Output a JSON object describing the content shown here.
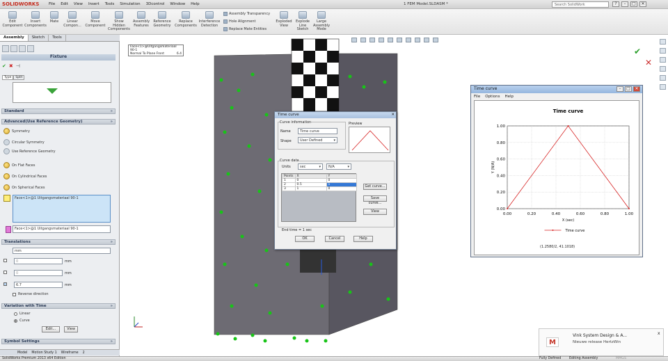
{
  "app": {
    "logo": "SOLIDWORKS",
    "menu": [
      "File",
      "Edit",
      "View",
      "Insert",
      "Tools",
      "Simulation",
      "3Dcontrol",
      "Window",
      "Help"
    ],
    "doc_title": "1 FEM Model.SLDASM *",
    "search_placeholder": "Search SolidWork",
    "win_controls": [
      "?",
      "–",
      "□",
      "✕"
    ]
  },
  "ribbon": {
    "buttons": [
      {
        "label": "Edit Component"
      },
      {
        "label": "Insert Components"
      },
      {
        "label": "Mate"
      },
      {
        "label": "Linear Compon..."
      },
      {
        "label": "Move Component"
      },
      {
        "label": "Show Hidden Components"
      },
      {
        "label": "Assembly Features"
      },
      {
        "label": "Reference Geometry"
      },
      {
        "label": "Replace Components"
      },
      {
        "label": "Interference Detection"
      },
      {
        "label": "Exploded View"
      },
      {
        "label": "Explode Line Sketch"
      },
      {
        "label": "Large Assembly Mode"
      }
    ],
    "small": [
      "Assembly Transparency",
      "Hole Alignment",
      "Replace Mate Entities"
    ]
  },
  "left_panel": {
    "tabs": [
      "Assembly",
      "Sketch",
      "Tools"
    ],
    "title": "Fixture",
    "type_tabs": [
      "Type",
      "Split"
    ],
    "standard_header": "Standard",
    "advanced_header": "Advanced(Use Reference Geometry)",
    "advanced_items": [
      "Symmetry",
      "Circular Symmetry",
      "Use Reference Geometry",
      "On Flat Faces",
      "On Cylindrical Faces",
      "On Spherical Faces"
    ],
    "face_selection": "Face<1>@1 Uitgangsmateriaal 90-1",
    "face_ref": "Face<1>@1 Uitgangsmateriaal 90-1",
    "translations_header": "Translations",
    "unit": "mm",
    "values": [
      {
        "value": "0",
        "unit": "mm"
      },
      {
        "value": "0",
        "unit": "mm"
      },
      {
        "value": "6.7",
        "unit": "mm"
      }
    ],
    "reverse_direction": "Reverse direction",
    "variation_header": "Variation with Time",
    "linear": "Linear",
    "curve": "Curve",
    "edit_btn": "Edit...",
    "view_btn": "View",
    "symbol_header": "Symbol Settings"
  },
  "bottom_tabs": [
    "Model",
    "Motion Study 1",
    "Wireframe",
    "2"
  ],
  "status": {
    "left": "SolidWorks Premium 2013 x64 Edition",
    "fully_defined": "Fully Defined",
    "editing": "Editing Assembly",
    "units": "MMGS"
  },
  "graphics": {
    "plane_label": "Face<1>@Uitgangsmateriaal 90-1",
    "plane_sub": "Normal To Plane Front",
    "plane_val": "6.4"
  },
  "dialog": {
    "title": "Time curve",
    "curve_info": "Curve information",
    "name_label": "Name",
    "name_value": "Time curve",
    "shape_label": "Shape",
    "shape_value": "User Defined",
    "preview": "Preview",
    "curve_data": "Curve data",
    "units_label": "Units",
    "unit_x": "sec",
    "unit_y": "N/A",
    "columns": [
      "Points",
      "X",
      "Y"
    ],
    "rows": [
      [
        "1",
        "0",
        "0"
      ],
      [
        "2",
        "0.5",
        "1"
      ],
      [
        "3",
        "1",
        "0"
      ]
    ],
    "get_curve": "Get curve...",
    "save_curve": "Save curve...",
    "view": "View",
    "end_time": "End time = 1 sec",
    "ok": "OK",
    "cancel": "Cancel",
    "help": "Help"
  },
  "chart_window": {
    "title": "Time curve",
    "menu": [
      "File",
      "Options",
      "Help"
    ],
    "footer": "(1.2580/2, 41.1018)"
  },
  "chart_data": {
    "type": "line",
    "title": "Time curve",
    "xlabel": "X (sec)",
    "ylabel": "Y (N/A)",
    "xlim": [
      0,
      1
    ],
    "ylim": [
      0,
      1
    ],
    "xticks": [
      "0.00",
      "0.20",
      "0.40",
      "0.60",
      "0.80",
      "1.00"
    ],
    "yticks": [
      "0.00",
      "0.20",
      "0.40",
      "0.60",
      "0.80",
      "1.00"
    ],
    "grid": true,
    "legend": "bottom",
    "series": [
      {
        "name": "Time curve",
        "color": "#d62020",
        "x": [
          0,
          0.5,
          1
        ],
        "y": [
          0,
          1,
          0
        ]
      }
    ]
  },
  "notification": {
    "title": "Vink System Design & A...",
    "body": "Nieuwe release HertzWin",
    "close": "x"
  }
}
